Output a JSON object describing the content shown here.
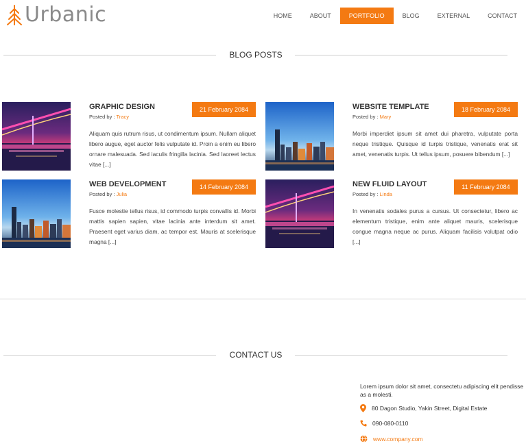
{
  "brand": {
    "name": "Urbanic",
    "accent": "#f47a12"
  },
  "nav": [
    {
      "label": "HOME",
      "active": false
    },
    {
      "label": "ABOUT",
      "active": false
    },
    {
      "label": "PORTFOLIO",
      "active": true
    },
    {
      "label": "BLOG",
      "active": false
    },
    {
      "label": "EXTERNAL",
      "active": false
    },
    {
      "label": "CONTACT",
      "active": false
    }
  ],
  "blog": {
    "heading": "BLOG POSTS",
    "posted_by_prefix": "Posted by : ",
    "posts": [
      {
        "title": "GRAPHIC DESIGN",
        "author": "Tracy",
        "date": "21 February 2084",
        "image": "bridge-night-photo",
        "excerpt": "Aliquam quis rutrum risus, ut condimentum ipsum. Nullam aliquet libero augue, eget auctor felis vulputate id. Proin a enim eu libero ornare malesuada. Sed iaculis fringilla lacinia. Sed laoreet lectus vitae [...]"
      },
      {
        "title": "WEBSITE TEMPLATE",
        "author": "Mary",
        "date": "18 February 2084",
        "image": "city-skyline-photo",
        "excerpt": "Morbi imperdiet ipsum sit amet dui pharetra, vulputate porta neque tristique. Quisque id turpis tristique, venenatis erat sit amet, venenatis turpis. Ut tellus ipsum, posuere bibendum [...]"
      },
      {
        "title": "WEB DEVELOPMENT",
        "author": "Julia",
        "date": "14 February 2084",
        "image": "city-skyline-photo",
        "excerpt": "Fusce molestie tellus risus, id commodo turpis convallis id. Morbi mattis sapien sapien, vitae lacinia ante interdum sit amet. Praesent eget varius diam, ac tempor est. Mauris at scelerisque magna [...]"
      },
      {
        "title": "NEW FLUID LAYOUT",
        "author": "Linda",
        "date": "11 February 2084",
        "image": "bridge-night-photo",
        "excerpt": "In venenatis sodales purus a cursus. Ut consectetur, libero ac elementum tristique, enim ante aliquet mauris, scelerisque congue magna neque ac purus. Aliquam facilisis volutpat odio [...]"
      }
    ]
  },
  "contact": {
    "heading": "CONTACT US",
    "intro": "Lorem ipsum dolor sit amet, consectetu adipiscing elit pendisse as a molesti.",
    "address": "80 Dagon Studio, Yakin Street, Digital Estate",
    "phone": "090-080-0110",
    "website": "www.company.com",
    "icons": [
      "map-pin-icon",
      "phone-icon",
      "globe-icon"
    ]
  }
}
